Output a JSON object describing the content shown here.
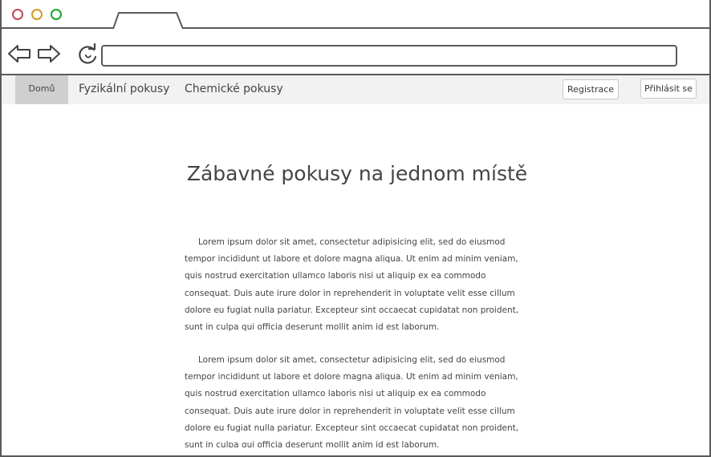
{
  "browser": {
    "address_value": "",
    "icons": [
      "back-arrow-icon",
      "forward-arrow-icon",
      "reload-icon"
    ]
  },
  "menu": {
    "home": "Domů",
    "physics": "Fyzikální pokusy",
    "chemistry": "Chemické pokusy",
    "register": "Registrace",
    "login": "Přihlásit se"
  },
  "main": {
    "title": "Zábavné pokusy na jednom místě",
    "paragraphs": [
      "Lorem ipsum dolor sit amet, consectetur adipisicing elit, sed do eiusmod tempor incididunt ut labore et dolore magna aliqua. Ut enim ad minim veniam, quis nostrud exercitation ullamco laboris nisi ut aliquip ex ea commodo consequat. Duis aute irure dolor in reprehenderit in voluptate velit esse cillum dolore eu fugiat nulla pariatur. Excepteur sint occaecat cupidatat non proident, sunt in culpa qui officia deserunt mollit anim id est laborum.",
      "Lorem ipsum dolor sit amet, consectetur adipisicing elit, sed do eiusmod tempor incididunt ut labore et dolore magna aliqua. Ut enim ad minim veniam, quis nostrud exercitation ullamco laboris nisi ut aliquip ex ea commodo consequat. Duis aute irure dolor in reprehenderit in voluptate velit esse cillum dolore eu fugiat nulla pariatur. Excepteur sint occaecat cupidatat non proident, sunt in culpa qui officia deserunt mollit anim id est laborum."
    ]
  },
  "colors": {
    "frame": "#5a5a5a",
    "menu_bg": "#f2f2f2",
    "active_tab_bg": "#cfcfcf",
    "close_dot": "#c0485a",
    "minimize_dot": "#d89a1e",
    "maximize_dot": "#19a52a"
  }
}
